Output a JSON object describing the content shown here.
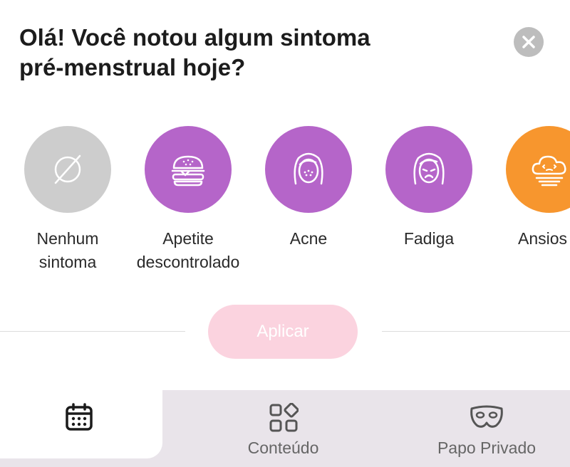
{
  "dialog": {
    "title": "Olá! Você notou algum sintoma\npré-menstrual hoje?",
    "close_icon": "close-icon"
  },
  "symptoms": [
    {
      "label": "Nenhum\nsintoma",
      "icon": "empty-set-icon",
      "color": "#cdcdcd"
    },
    {
      "label": "Apetite\ndescontrolado",
      "icon": "burger-icon",
      "color": "#b565c9"
    },
    {
      "label": "Acne",
      "icon": "acne-face-icon",
      "color": "#b565c9"
    },
    {
      "label": "Fadiga",
      "icon": "sad-face-icon",
      "color": "#b565c9"
    },
    {
      "label": "Ansios",
      "icon": "anxious-cloud-icon",
      "color": "#f7962e"
    }
  ],
  "apply_button": {
    "label": "Aplicar",
    "color": "#fbd3df"
  },
  "bottom_nav": {
    "items": [
      {
        "label": "",
        "icon": "calendar-icon",
        "active": true
      },
      {
        "label": "Conteúdo",
        "icon": "content-grid-icon",
        "active": false
      },
      {
        "label": "Papo Privado",
        "icon": "mask-icon",
        "active": false
      }
    ]
  }
}
